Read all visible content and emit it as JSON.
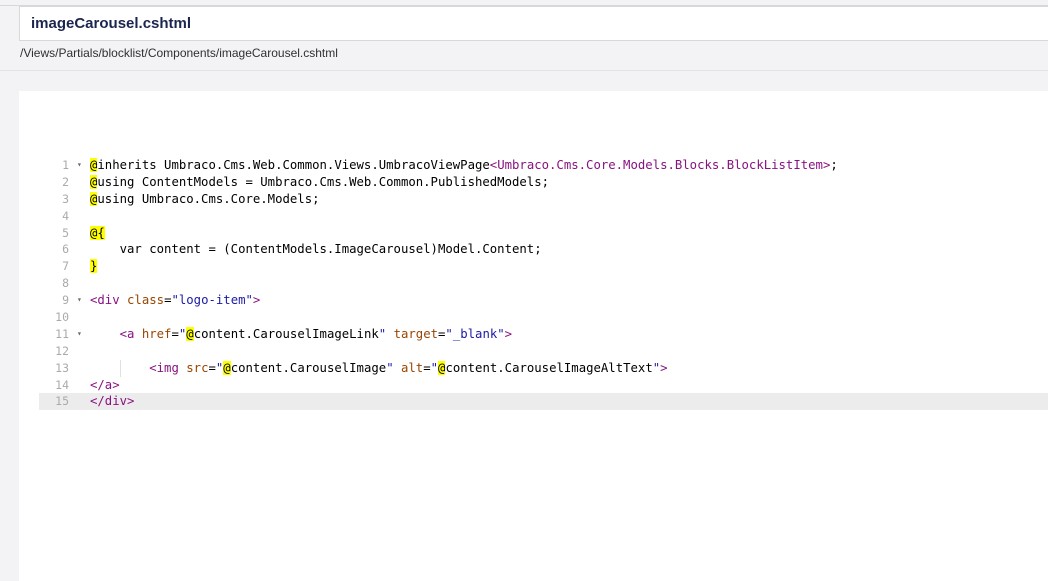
{
  "file": {
    "name": "imageCarousel.cshtml",
    "path": "/Views/Partials/blocklist/Components/imageCarousel.cshtml"
  },
  "editor": {
    "lines": [
      {
        "n": "1",
        "fold": "▾",
        "parts": [
          [
            "hl",
            "@"
          ],
          [
            "plain",
            "inherits Umbraco.Cms.Web.Common.Views.UmbracoViewPage"
          ],
          [
            "tag",
            "<Umbraco.Cms.Core.Models.Blocks.BlockListItem>"
          ],
          [
            "plain",
            ";"
          ]
        ]
      },
      {
        "n": "2",
        "fold": "",
        "parts": [
          [
            "hl",
            "@"
          ],
          [
            "plain",
            "using ContentModels = Umbraco.Cms.Web.Common.PublishedModels;"
          ]
        ]
      },
      {
        "n": "3",
        "fold": "",
        "parts": [
          [
            "hl",
            "@"
          ],
          [
            "plain",
            "using Umbraco.Cms.Core.Models;"
          ]
        ]
      },
      {
        "n": "4",
        "fold": "",
        "parts": []
      },
      {
        "n": "5",
        "fold": "",
        "parts": [
          [
            "hl",
            "@{"
          ]
        ]
      },
      {
        "n": "6",
        "fold": "",
        "parts": [
          [
            "plain",
            "    var content = (ContentModels.ImageCarousel)Model.Content;"
          ]
        ]
      },
      {
        "n": "7",
        "fold": "",
        "parts": [
          [
            "hl",
            "}"
          ]
        ]
      },
      {
        "n": "8",
        "fold": "",
        "parts": []
      },
      {
        "n": "9",
        "fold": "▾",
        "parts": [
          [
            "tag",
            "<div "
          ],
          [
            "attr",
            "class"
          ],
          [
            "plain",
            "="
          ],
          [
            "str",
            "\"logo-item\""
          ],
          [
            "tag",
            ">"
          ]
        ]
      },
      {
        "n": "10",
        "fold": "",
        "parts": []
      },
      {
        "n": "11",
        "fold": "▾",
        "parts": [
          [
            "plain",
            "    "
          ],
          [
            "tag",
            "<a "
          ],
          [
            "attr",
            "href"
          ],
          [
            "plain",
            "="
          ],
          [
            "str",
            "\""
          ],
          [
            "hl",
            "@"
          ],
          [
            "plain",
            "content.CarouselImageLink"
          ],
          [
            "str",
            "\""
          ],
          [
            "plain",
            " "
          ],
          [
            "attr",
            "target"
          ],
          [
            "plain",
            "="
          ],
          [
            "str",
            "\"_blank\""
          ],
          [
            "tag",
            ">"
          ]
        ]
      },
      {
        "n": "12",
        "fold": "",
        "parts": []
      },
      {
        "n": "13",
        "fold": "",
        "parts": [
          [
            "plain",
            "        "
          ],
          [
            "tag",
            "<img "
          ],
          [
            "attr",
            "src"
          ],
          [
            "plain",
            "="
          ],
          [
            "str",
            "\""
          ],
          [
            "hl",
            "@"
          ],
          [
            "plain",
            "content.CarouselImage"
          ],
          [
            "str",
            "\""
          ],
          [
            "plain",
            " "
          ],
          [
            "attr",
            "alt"
          ],
          [
            "plain",
            "="
          ],
          [
            "str",
            "\""
          ],
          [
            "hl",
            "@"
          ],
          [
            "plain",
            "content.CarouselImageAltText"
          ],
          [
            "str",
            "\""
          ],
          [
            "tag",
            ">"
          ]
        ]
      },
      {
        "n": "14",
        "fold": "",
        "parts": [
          [
            "tag",
            "</a>"
          ]
        ]
      },
      {
        "n": "15",
        "fold": "",
        "active": true,
        "parts": [
          [
            "tag",
            "</div>"
          ]
        ]
      }
    ]
  }
}
